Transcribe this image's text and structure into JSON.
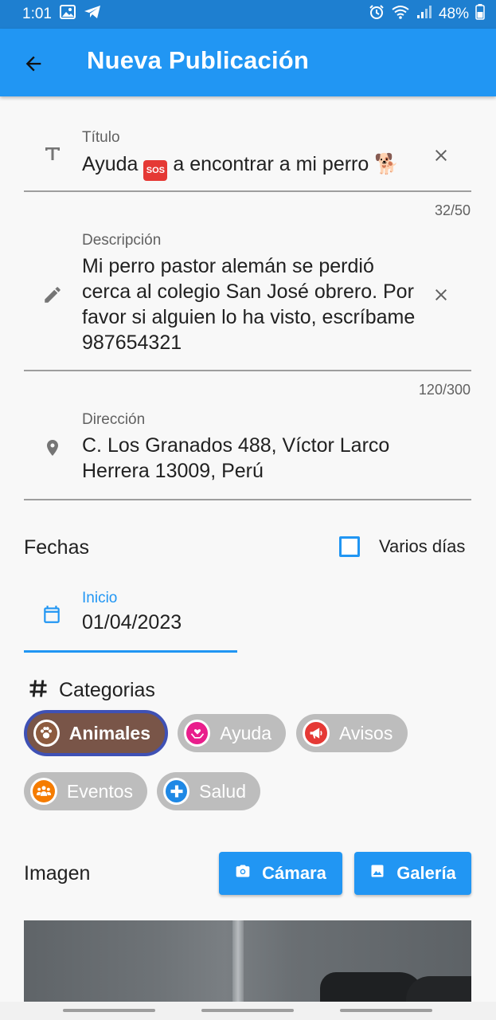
{
  "status_bar": {
    "time": "1:01",
    "battery": "48%",
    "icons": [
      "image-icon",
      "telegram-icon",
      "alarm-icon",
      "wifi-icon",
      "signal-icon",
      "battery-icon"
    ]
  },
  "app_bar": {
    "title": "Nueva Publicación",
    "back_icon": "arrow-back-icon"
  },
  "form": {
    "title": {
      "label": "Título",
      "value_prefix": "Ayuda",
      "value_emoji": "SOS",
      "value_suffix": "a encontrar a mi perro 🐕",
      "counter": "32/50",
      "icon": "text-icon"
    },
    "description": {
      "label": "Descripción",
      "value": "Mi perro pastor alemán se perdió cerca al colegio San José obrero. Por favor si alguien lo ha visto, escríbame 987654321",
      "counter": "120/300",
      "icon": "pencil-icon"
    },
    "address": {
      "label": "Dirección",
      "value": "C. Los Granados 488, Víctor Larco Herrera 13009, Perú",
      "icon": "location-pin-icon"
    }
  },
  "dates": {
    "section_title": "Fechas",
    "multi_day_label": "Varios días",
    "multi_day_checked": false,
    "start_label": "Inicio",
    "start_value": "01/04/2023"
  },
  "categories": {
    "section_title": "Categorias",
    "items": [
      {
        "label": "Animales",
        "selected": true,
        "color": "#795548",
        "icon_color": "#8d5b3f",
        "icon": "paw-icon"
      },
      {
        "label": "Ayuda",
        "selected": false,
        "color": "#bdbdbd",
        "icon_color": "#e91e8c",
        "icon": "help-hands-icon"
      },
      {
        "label": "Avisos",
        "selected": false,
        "color": "#bdbdbd",
        "icon_color": "#e53935",
        "icon": "megaphone-icon"
      },
      {
        "label": "Eventos",
        "selected": false,
        "color": "#bdbdbd",
        "icon_color": "#f57c00",
        "icon": "people-icon"
      },
      {
        "label": "Salud",
        "selected": false,
        "color": "#bdbdbd",
        "icon_color": "#1e88e5",
        "icon": "health-cross-icon"
      }
    ]
  },
  "image": {
    "section_title": "Imagen",
    "camera_label": "Cámara",
    "gallery_label": "Galería"
  },
  "colors": {
    "primary": "#2196f3",
    "status_bar": "#1e7fd0",
    "chip_selected_border": "#3f51b5"
  }
}
